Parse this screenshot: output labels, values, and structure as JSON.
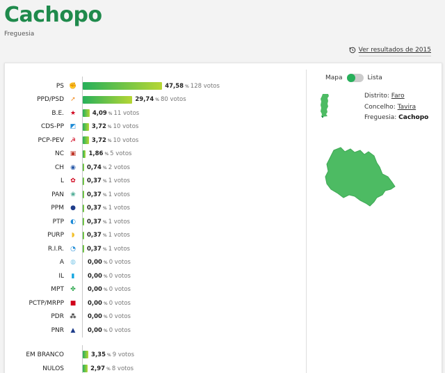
{
  "header": {
    "title": "Cachopo",
    "subtitle": "Freguesia",
    "prev_results_label": "Ver resultados de 2015"
  },
  "results": [
    {
      "party": "PS",
      "pct": "47,58",
      "votes": "128 votos",
      "value": 47.58,
      "logo": "ps-logo",
      "color": "#e8433d"
    },
    {
      "party": "PPD/PSD",
      "pct": "29,74",
      "votes": "80 votos",
      "value": 29.74,
      "logo": "psd-logo",
      "color": "#f28a1c"
    },
    {
      "party": "B.E.",
      "pct": "4,09",
      "votes": "11 votos",
      "value": 4.09,
      "logo": "be-logo",
      "color": "#d0021b"
    },
    {
      "party": "CDS-PP",
      "pct": "3,72",
      "votes": "10 votos",
      "value": 3.72,
      "logo": "cds-logo",
      "color": "#1c8ad6"
    },
    {
      "party": "PCP-PEV",
      "pct": "3,72",
      "votes": "10 votos",
      "value": 3.72,
      "logo": "pcp-logo",
      "color": "#d0021b"
    },
    {
      "party": "NC",
      "pct": "1,86",
      "votes": "5 votos",
      "value": 1.86,
      "logo": "nc-logo",
      "color": "#c0392b"
    },
    {
      "party": "CH",
      "pct": "0,74",
      "votes": "2 votos",
      "value": 0.74,
      "logo": "ch-logo",
      "color": "#2a5aa8"
    },
    {
      "party": "L",
      "pct": "0,37",
      "votes": "1 votos",
      "value": 0.37,
      "logo": "l-logo",
      "color": "#d0021b"
    },
    {
      "party": "PAN",
      "pct": "0,37",
      "votes": "1 votos",
      "value": 0.37,
      "logo": "pan-logo",
      "color": "#3aa389"
    },
    {
      "party": "PPM",
      "pct": "0,37",
      "votes": "1 votos",
      "value": 0.37,
      "logo": "ppm-logo",
      "color": "#1e3c8a"
    },
    {
      "party": "PTP",
      "pct": "0,37",
      "votes": "1 votos",
      "value": 0.37,
      "logo": "ptp-logo",
      "color": "#1c8ad6"
    },
    {
      "party": "PURP",
      "pct": "0,37",
      "votes": "1 votos",
      "value": 0.37,
      "logo": "purp-logo",
      "color": "#f2c12e"
    },
    {
      "party": "R.I.R.",
      "pct": "0,37",
      "votes": "1 votos",
      "value": 0.37,
      "logo": "rir-logo",
      "color": "#1c8ad6"
    },
    {
      "party": "A",
      "pct": "0,00",
      "votes": "0 votos",
      "value": 0,
      "logo": "a-logo",
      "color": "#7fc9e8"
    },
    {
      "party": "IL",
      "pct": "0,00",
      "votes": "0 votos",
      "value": 0,
      "logo": "il-logo",
      "color": "#12a5e0"
    },
    {
      "party": "MPT",
      "pct": "0,00",
      "votes": "0 votos",
      "value": 0,
      "logo": "mpt-logo",
      "color": "#2fa84f"
    },
    {
      "party": "PCTP/MRPP",
      "pct": "0,00",
      "votes": "0 votos",
      "value": 0,
      "logo": "mrpp-logo",
      "color": "#d0021b"
    },
    {
      "party": "PDR",
      "pct": "0,00",
      "votes": "0 votos",
      "value": 0,
      "logo": "pdr-logo",
      "color": "#222222"
    },
    {
      "party": "PNR",
      "pct": "0,00",
      "votes": "0 votos",
      "value": 0,
      "logo": "pnr-logo",
      "color": "#1e3c8a"
    }
  ],
  "other_results": [
    {
      "party": "EM BRANCO",
      "pct": "3,35",
      "votes": "9 votos",
      "value": 3.35
    },
    {
      "party": "NULOS",
      "pct": "2,97",
      "votes": "8 votos",
      "value": 2.97
    }
  ],
  "pct_sign": "%",
  "toggle": {
    "left": "Mapa",
    "right": "Lista"
  },
  "location": {
    "distrito_label": "Distrito:",
    "distrito_value": "Faro",
    "concelho_label": "Concelho:",
    "concelho_value": "Tavira",
    "freguesia_label": "Freguesia:",
    "freguesia_value": "Cachopo"
  },
  "colors": {
    "title": "#1f8a4c",
    "bar_start": "#27b05a",
    "bar_end": "#b6d634",
    "map_fill": "#4dbb63"
  }
}
